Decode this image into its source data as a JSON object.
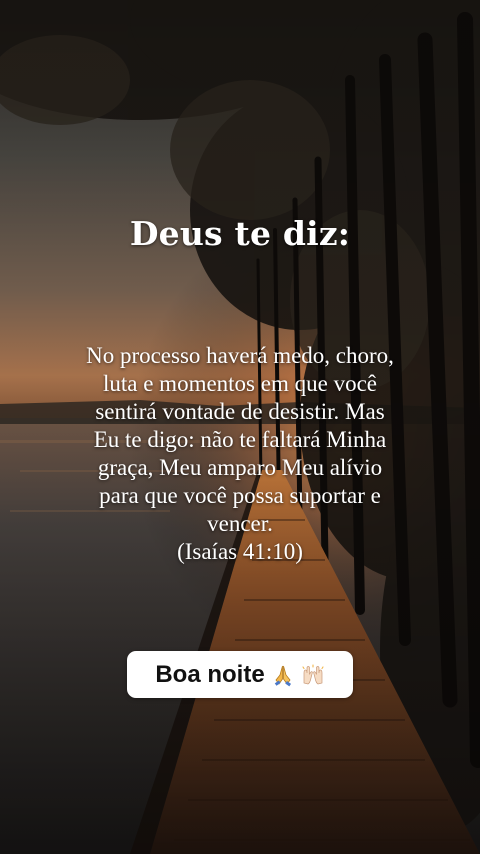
{
  "post": {
    "title": "Deus te diz:",
    "message_lines": [
      "No processo haverá medo, choro,",
      "luta e momentos em que você",
      "sentirá vontade de desistir. Mas",
      "Eu te digo: não te faltará Minha",
      "graça, Meu amparo Meu alívio",
      "para que você possa suportar e",
      "vencer.",
      "(Isaías 41:10)"
    ],
    "sticker_text": "Boa noite",
    "sticker_icons": [
      "praying-hands-icon",
      "raising-hands-icon"
    ]
  },
  "colors": {
    "text": "#ffffff",
    "sticker_bg": "#ffffff",
    "sticker_text": "#111111"
  }
}
